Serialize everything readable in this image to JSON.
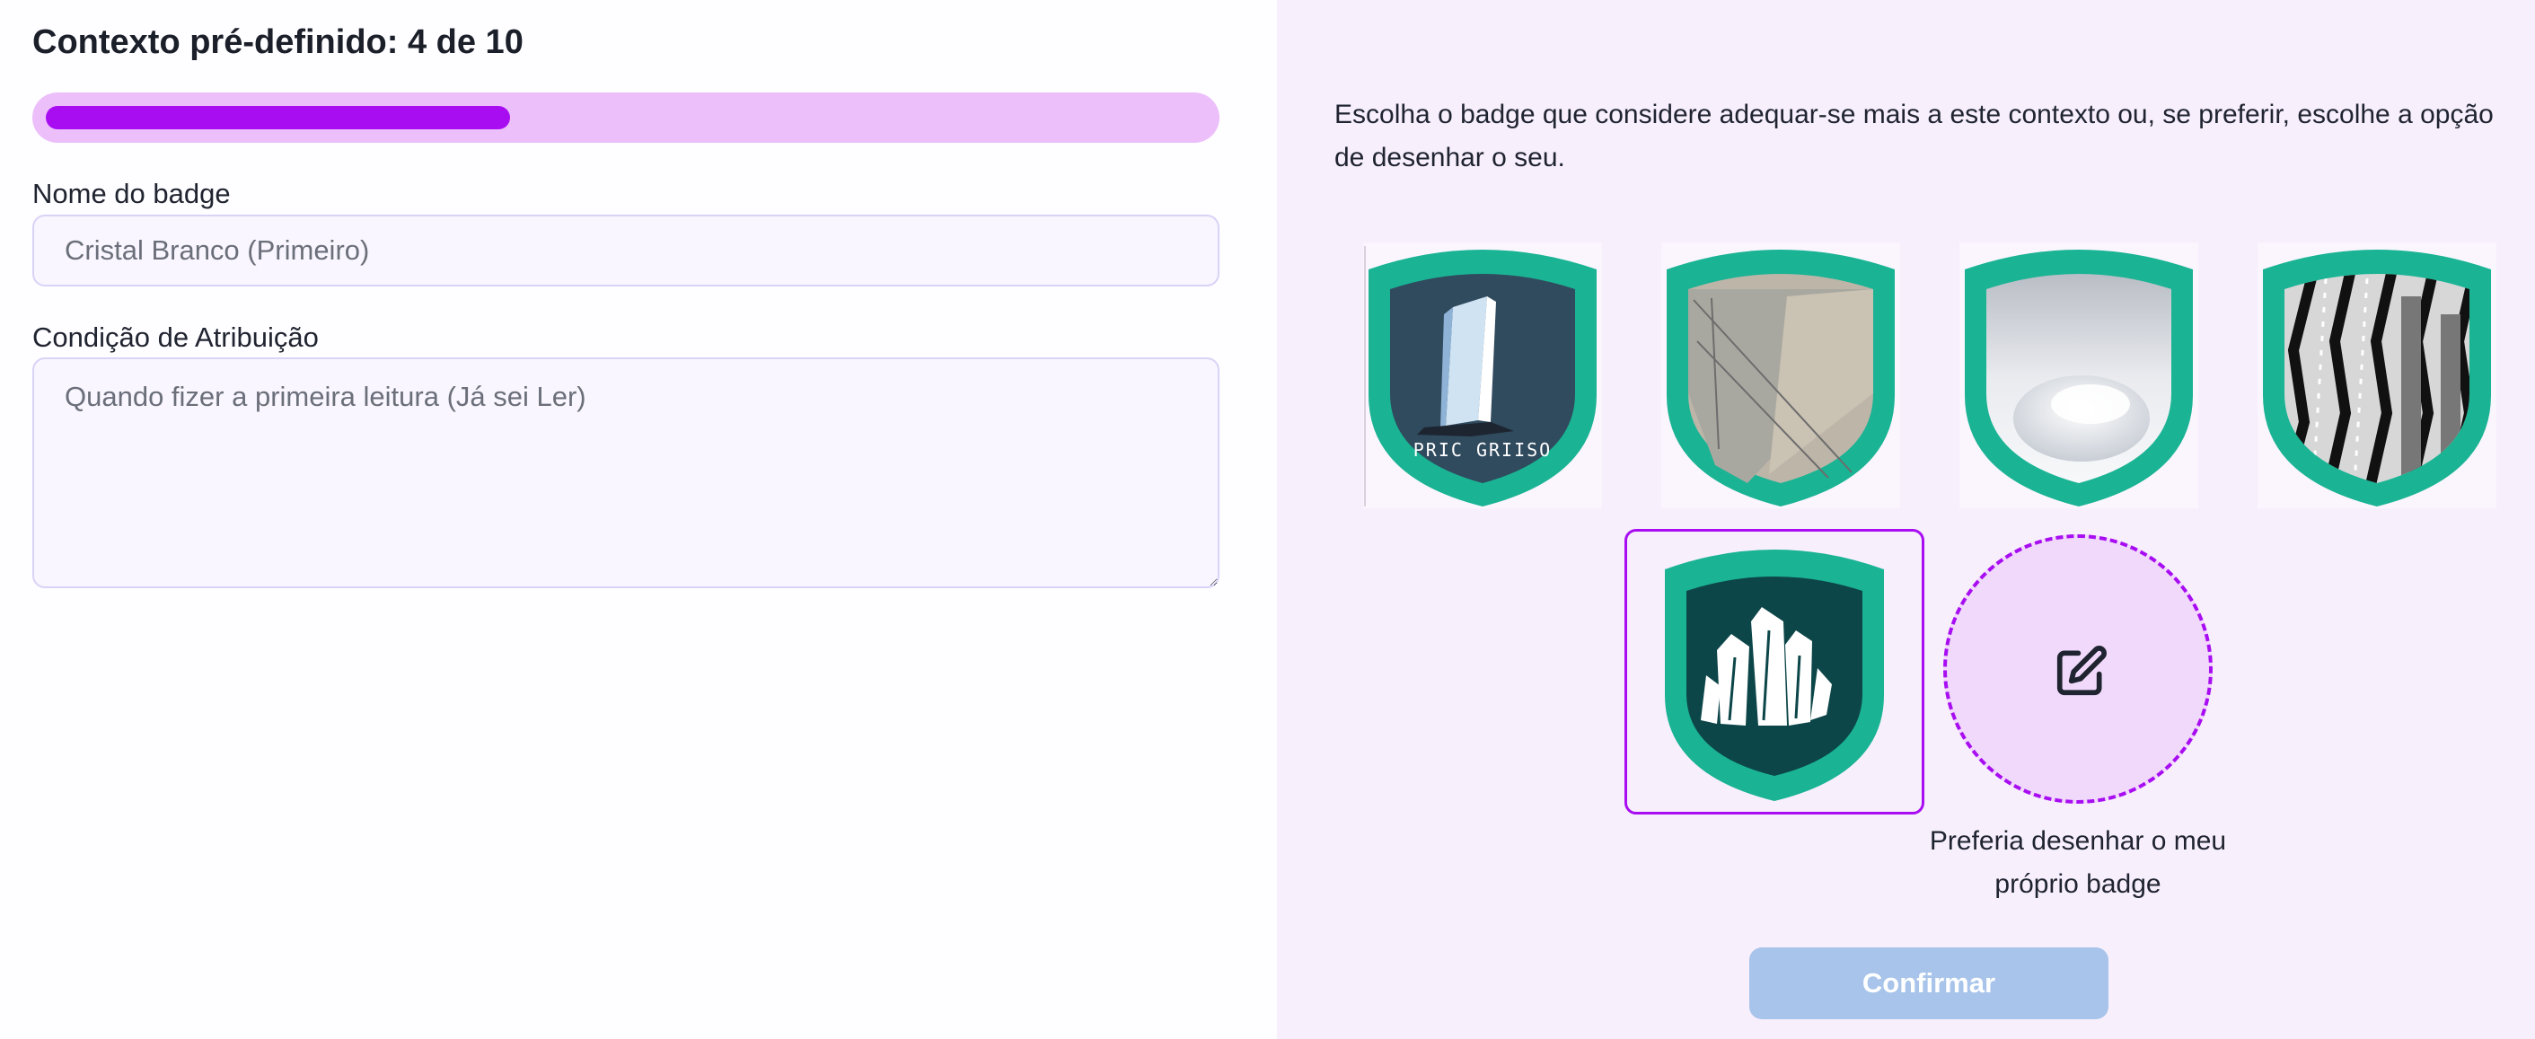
{
  "header": {
    "title": "Contexto pré-definido: 4 de 10"
  },
  "progress": {
    "current": 4,
    "total": 10,
    "percent": 40
  },
  "form": {
    "name_label": "Nome do badge",
    "name_placeholder": "Cristal Branco (Primeiro)",
    "name_value": "",
    "condition_label": "Condição de Atribuição",
    "condition_placeholder": "Quando fizer a primeira leitura (Já sei Ler)",
    "condition_value": ""
  },
  "selection": {
    "instruction": "Escolha o badge que considere adequar-se mais a este contexto ou, se preferir, escolhe a opção de desenhar o seu.",
    "badges": [
      {
        "id": "badge-1",
        "caption": "PRIC GRIISO",
        "selected": false
      },
      {
        "id": "badge-2",
        "caption": "",
        "selected": false
      },
      {
        "id": "badge-3",
        "caption": "",
        "selected": false
      },
      {
        "id": "badge-4",
        "caption": "",
        "selected": false
      },
      {
        "id": "badge-5",
        "caption": "",
        "selected": true
      }
    ],
    "draw_option": {
      "label": "Preferia desenhar o meu próprio badge",
      "icon": "edit-icon"
    },
    "confirm_label": "Confirmar"
  },
  "colors": {
    "accent": "#a80df2",
    "progress_track": "#ecbffb",
    "shield_rim": "#1ab394",
    "confirm_disabled": "#a8c4ea",
    "right_panel_bg": "#f8effd"
  }
}
